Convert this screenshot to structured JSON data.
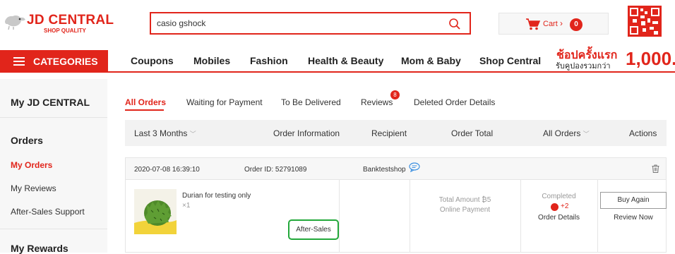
{
  "header": {
    "logo_text": "JD CENTRAL",
    "logo_sub": "SHOP QUALITY",
    "search_value": "casio gshock",
    "cart_label": "Cart",
    "cart_count": "0"
  },
  "nav": {
    "categories_label": "CATEGORIES",
    "links": [
      "Coupons",
      "Mobiles",
      "Fashion",
      "Health & Beauty",
      "Mom & Baby",
      "Shop Central"
    ],
    "promo_title": "ช้อปครั้งแรก",
    "promo_sub": "รับคูปองรวมกว่า",
    "promo_amount": "1,000."
  },
  "sidebar": {
    "title": "My JD CENTRAL",
    "orders_heading": "Orders",
    "items": [
      "My Orders",
      "My Reviews",
      "After-Sales Support"
    ],
    "rewards_heading": "My Rewards"
  },
  "tabs": {
    "items": [
      "All Orders",
      "Waiting for Payment",
      "To Be Delivered",
      "Reviews",
      "Deleted Order Details"
    ],
    "reviews_badge": "8"
  },
  "columns": {
    "range": "Last 3 Months",
    "order_info": "Order Information",
    "recipient": "Recipient",
    "order_total": "Order Total",
    "status_filter": "All Orders",
    "actions": "Actions"
  },
  "order": {
    "datetime": "2020-07-08 16:39:10",
    "order_id": "Order ID: 52791089",
    "shop": "Banktestshop",
    "product_name": "Durian for testing only",
    "quantity": "×1",
    "after_sales": "After-Sales",
    "total_amount": "Total Amount ₿5",
    "payment": "Online Payment",
    "status": "Completed",
    "coins": "+2",
    "order_details": "Order Details",
    "buy_again": "Buy Again",
    "review_now": "Review Now"
  },
  "colors": {
    "brand_red": "#e1251b",
    "after_sales_border": "#22a83a"
  }
}
